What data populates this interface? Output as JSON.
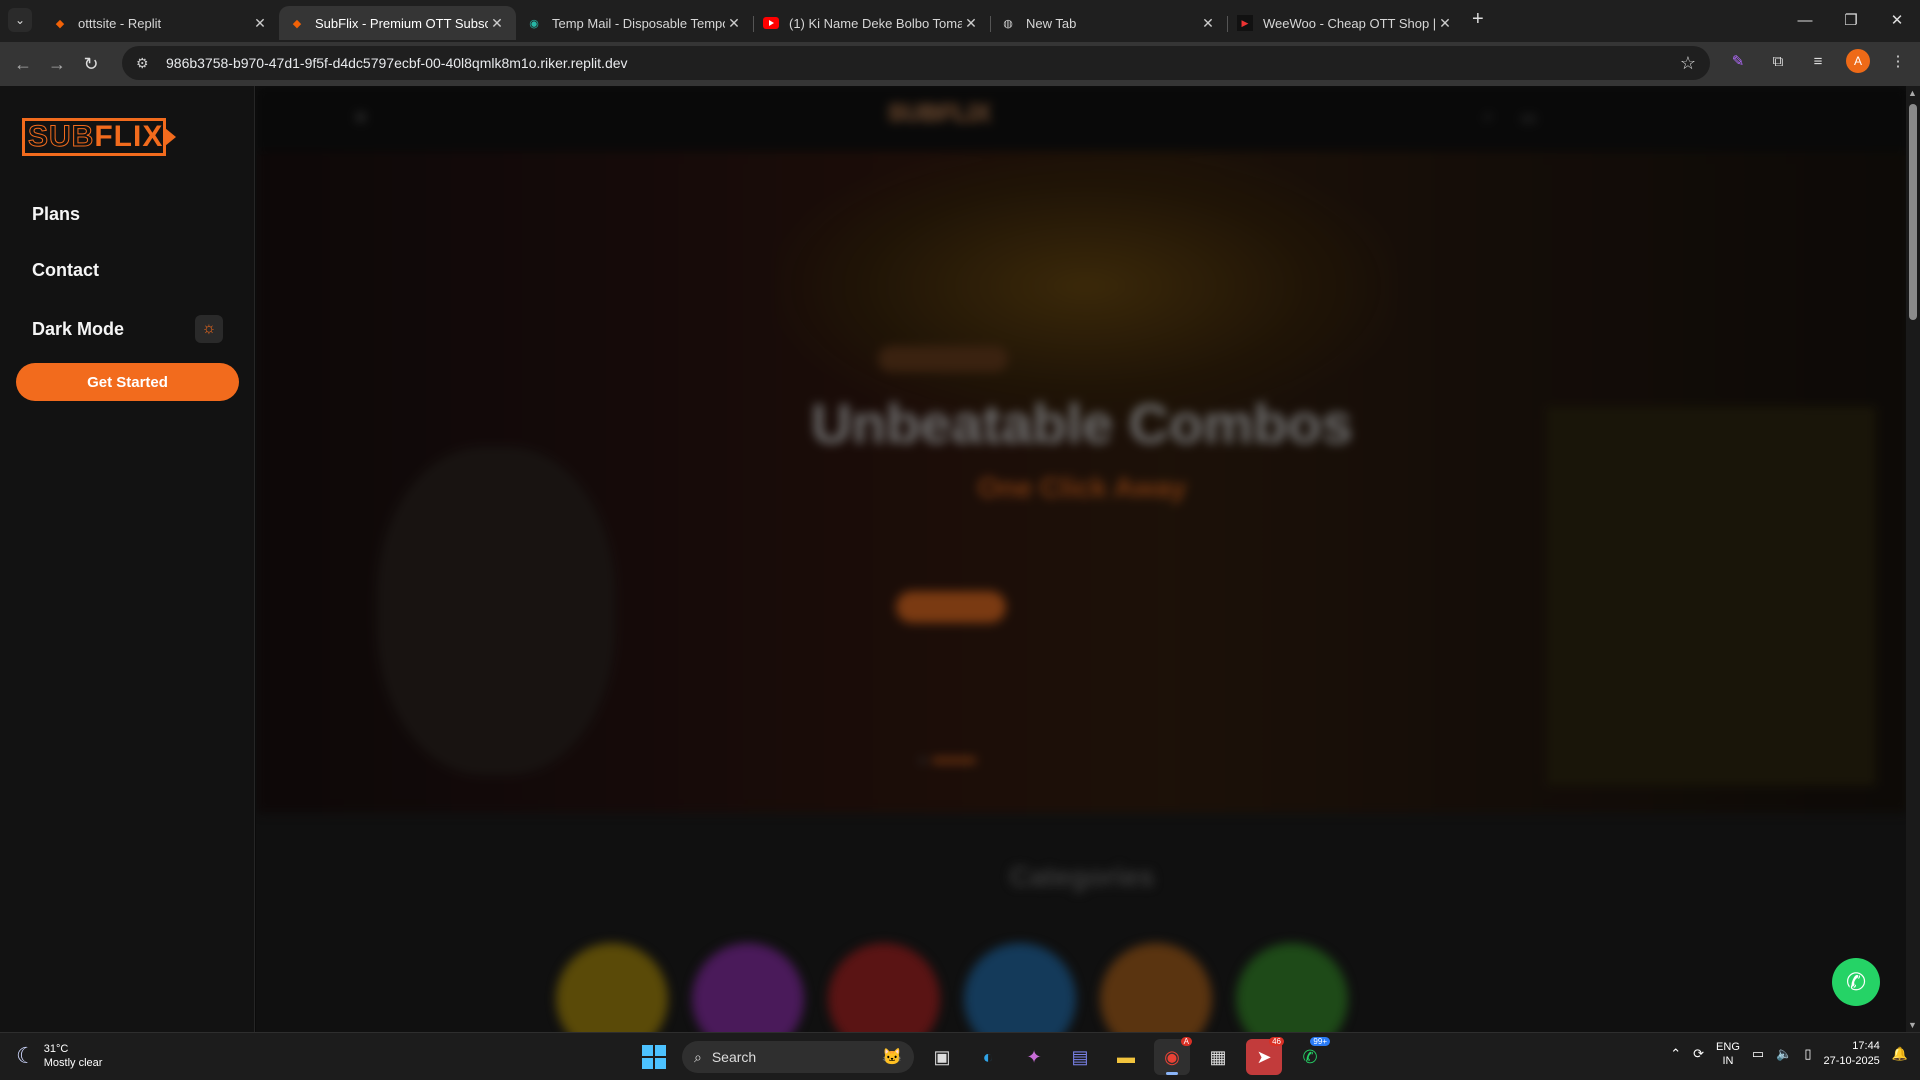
{
  "browser": {
    "tabs": [
      {
        "title": "otttsite - Replit",
        "favicon": "replit-icon"
      },
      {
        "title": "SubFlix - Premium OTT Subscrip",
        "favicon": "replit-icon",
        "active": true
      },
      {
        "title": "Temp Mail - Disposable Tempor",
        "favicon": "globe-icon"
      },
      {
        "title": "(1) Ki Name Deke Bolbo Tomak",
        "favicon": "youtube-icon"
      },
      {
        "title": "New Tab",
        "favicon": "chrome-icon"
      },
      {
        "title": "WeeWoo - Cheap OTT Shop | M",
        "favicon": "weewoo-icon"
      }
    ],
    "url": "986b3758-b970-47d1-9f5f-d4dc5797ecbf-00-40l8qmlk8m1o.riker.replit.dev",
    "profile_initial": "A"
  },
  "sidebar": {
    "logo": {
      "sub": "SUB",
      "flix": "FLIX"
    },
    "items": [
      {
        "label": "Plans"
      },
      {
        "label": "Contact"
      },
      {
        "label": "Dark Mode"
      }
    ],
    "cta_label": "Get Started"
  },
  "site": {
    "header_logo": "SUBFLIX",
    "hero": {
      "title": "Unbeatable Combos",
      "subtitle": "One Click Away"
    },
    "categories_title": "Categories"
  },
  "colors": {
    "accent": "#f26b1d",
    "whatsapp": "#25d366"
  },
  "taskbar": {
    "weather_temp": "31°C",
    "weather_desc": "Mostly clear",
    "search_label": "Search",
    "telegram_badge": "46",
    "whatsapp_badge": "99+",
    "chrome_badge": "A",
    "lang_line1": "ENG",
    "lang_line2": "IN",
    "time": "17:44",
    "date": "27-10-2025"
  }
}
